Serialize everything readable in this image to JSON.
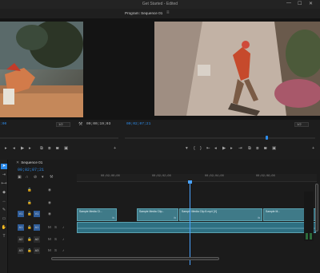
{
  "app": {
    "window_title": "Get Started - Edited",
    "controls": [
      "—",
      "☐",
      "✕"
    ]
  },
  "source_monitor": {
    "timecode_in": ":00",
    "zoom": "1/2",
    "timecode_out": "00;00;19;03"
  },
  "program_monitor": {
    "tab_label": "Program: Sequence 01",
    "timecode": "00;02;07;21",
    "zoom": "1/2"
  },
  "timeline": {
    "sequence_tab": "Sequence 01",
    "timecode": "00;02;07;21",
    "ruler_ticks": [
      "00;02;00;00",
      "00;02;02;00",
      "00;02;04;00",
      "00;02;06;00"
    ],
    "tracks": [
      {
        "label": "V1",
        "source": "V1"
      },
      {
        "label": "A1",
        "source": "A1"
      },
      {
        "label": "A2",
        "source": "A2"
      },
      {
        "label": "A3",
        "source": "A3"
      }
    ],
    "clips": [
      {
        "name": "Sample Media Cl...",
        "fx": "fx"
      },
      {
        "name": "Sample Media Clip...",
        "fx": "fx"
      },
      {
        "name": "Sample Media Clip 8.mp4 [V]",
        "fx": "fx"
      },
      {
        "name": "Sample M...",
        "fx": "fx"
      }
    ]
  },
  "colors": {
    "accent": "#2d8ceb",
    "clip_video": "#3f7a88",
    "clip_audio": "#2e6f82"
  }
}
